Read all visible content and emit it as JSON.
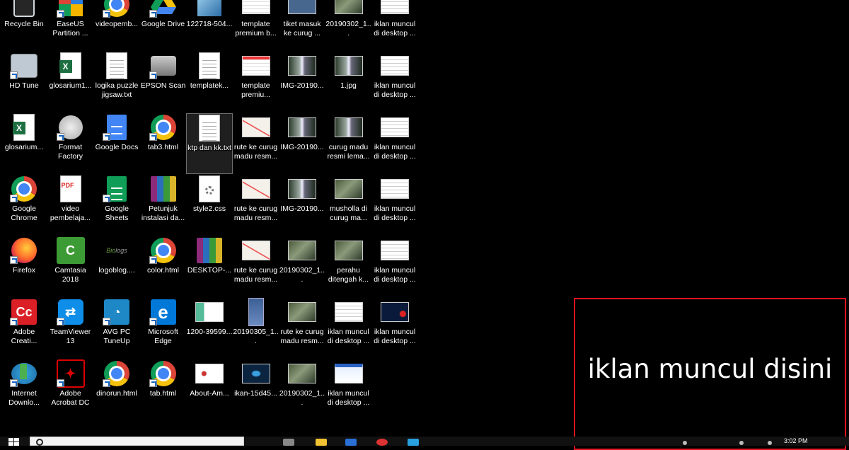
{
  "desktop": {
    "icons": [
      {
        "label": "Recycle Bin",
        "icon": "recycle-bin-icon"
      },
      {
        "label": "EaseUS Partition ...",
        "icon": "easeus-icon"
      },
      {
        "label": "videopemb...",
        "icon": "chrome-icon"
      },
      {
        "label": "Google Drive",
        "icon": "google-drive-icon"
      },
      {
        "label": "122718-504...",
        "icon": "image-file-icon"
      },
      {
        "label": "template premium b...",
        "icon": "web-thumbnail-icon"
      },
      {
        "label": "tiket masuk ke curug ...",
        "icon": "ticket-thumbnail-icon"
      },
      {
        "label": "20190302_1...",
        "icon": "photo-thumbnail-icon"
      },
      {
        "label": "iklan muncul di desktop ...",
        "icon": "screenshot-thumbnail-icon"
      },
      {
        "label": "HD Tune",
        "icon": "hd-tune-icon"
      },
      {
        "label": "glosarium1...",
        "icon": "excel-file-icon"
      },
      {
        "label": "logika puzzle jigsaw.txt",
        "icon": "text-file-icon"
      },
      {
        "label": "EPSON Scan",
        "icon": "scanner-icon"
      },
      {
        "label": "templatek...",
        "icon": "text-file-icon"
      },
      {
        "label": "template premiu...",
        "icon": "web-thumbnail-icon"
      },
      {
        "label": "IMG-20190...",
        "icon": "waterfall-thumbnail-icon"
      },
      {
        "label": "1.jpg",
        "icon": "waterfall-thumbnail-icon"
      },
      {
        "label": "iklan muncul di desktop ...",
        "icon": "screenshot-thumbnail-icon"
      },
      {
        "label": "glosarium...",
        "icon": "excel-file-icon"
      },
      {
        "label": "Format Factory",
        "icon": "format-factory-icon"
      },
      {
        "label": "Google Docs",
        "icon": "google-docs-icon"
      },
      {
        "label": "tab3.html",
        "icon": "chrome-icon"
      },
      {
        "label": "ktp dan kk.txt",
        "icon": "text-file-icon"
      },
      {
        "label": "rute ke curug madu resm...",
        "icon": "map-thumbnail-icon"
      },
      {
        "label": "IMG-20190...",
        "icon": "waterfall-thumbnail-icon"
      },
      {
        "label": "curug madu resmi lema...",
        "icon": "waterfall-thumbnail-icon"
      },
      {
        "label": "iklan muncul di desktop ...",
        "icon": "screenshot-thumbnail-icon"
      },
      {
        "label": "Google Chrome",
        "icon": "chrome-icon"
      },
      {
        "label": "video pembelaja...",
        "icon": "pdf-file-icon"
      },
      {
        "label": "Google Sheets",
        "icon": "google-sheets-icon"
      },
      {
        "label": "Petunjuk instalasi da...",
        "icon": "winrar-icon"
      },
      {
        "label": "style2.css",
        "icon": "css-file-icon"
      },
      {
        "label": "rute ke curug madu resm...",
        "icon": "map-thumbnail-icon"
      },
      {
        "label": "IMG-20190...",
        "icon": "waterfall-thumbnail-icon"
      },
      {
        "label": "musholla di curug ma...",
        "icon": "photo-thumbnail-icon"
      },
      {
        "label": "iklan muncul di desktop ...",
        "icon": "screenshot-thumbnail-icon"
      },
      {
        "label": "Firefox",
        "icon": "firefox-icon"
      },
      {
        "label": "Camtasia 2018",
        "icon": "camtasia-icon"
      },
      {
        "label": "logoblog....",
        "icon": "logo-image-icon"
      },
      {
        "label": "color.html",
        "icon": "chrome-icon"
      },
      {
        "label": "DESKTOP-...",
        "icon": "winrar-icon"
      },
      {
        "label": "rute ke curug madu resm...",
        "icon": "map-thumbnail-icon"
      },
      {
        "label": "20190302_1...",
        "icon": "photo-thumbnail-icon"
      },
      {
        "label": "perahu ditengah k...",
        "icon": "photo-thumbnail-icon"
      },
      {
        "label": "iklan muncul di desktop ...",
        "icon": "screenshot-thumbnail-icon"
      },
      {
        "label": "Adobe Creati...",
        "icon": "adobe-cc-icon"
      },
      {
        "label": "TeamViewer 13",
        "icon": "teamviewer-icon"
      },
      {
        "label": "AVG PC TuneUp",
        "icon": "avg-icon"
      },
      {
        "label": "Microsoft Edge",
        "icon": "edge-icon"
      },
      {
        "label": "1200-39599...",
        "icon": "banner-thumbnail-icon"
      },
      {
        "label": "20190305_1...",
        "icon": "scroll-thumbnail-icon"
      },
      {
        "label": "rute ke curug madu resm...",
        "icon": "photo-thumbnail-icon"
      },
      {
        "label": "iklan muncul di desktop ...",
        "icon": "screenshot-thumbnail-icon"
      },
      {
        "label": "iklan muncul di desktop ...",
        "icon": "dark-screenshot-thumbnail-icon"
      },
      {
        "label": "Internet Downlo...",
        "icon": "idm-icon"
      },
      {
        "label": "Adobe Acrobat DC",
        "icon": "acrobat-icon"
      },
      {
        "label": "dinorun.html",
        "icon": "chrome-icon"
      },
      {
        "label": "tab.html",
        "icon": "chrome-icon"
      },
      {
        "label": "About-Am...",
        "icon": "white-thumbnail-icon"
      },
      {
        "label": "ikan-15d45...",
        "icon": "fish-thumbnail-icon"
      },
      {
        "label": "20190302_1...",
        "icon": "photo-thumbnail-icon"
      },
      {
        "label": "iklan muncul di desktop ...",
        "icon": "blue-screenshot-thumbnail-icon"
      }
    ]
  },
  "ad": {
    "text": "iklan muncul disini",
    "border_color": "#e0141e"
  },
  "taskbar": {
    "clock": "3:02 PM"
  }
}
